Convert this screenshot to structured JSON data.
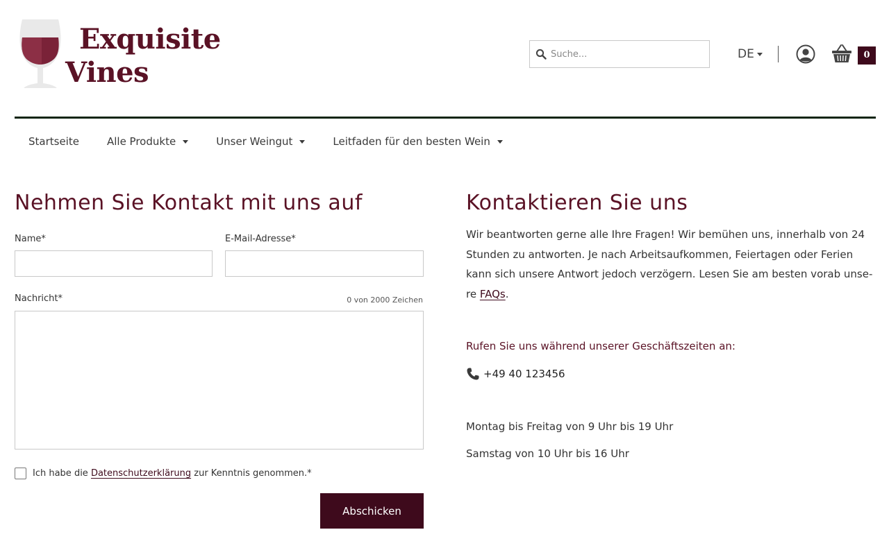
{
  "brand": {
    "name_line1": "Exquisite",
    "name_line2": "Vines",
    "color": "#5a1225",
    "icon": "wine-glass-icon"
  },
  "header": {
    "search": {
      "placeholder": "Suche...",
      "value": "",
      "icon": "search-icon"
    },
    "language": "DE",
    "account_icon": "user-icon",
    "cart": {
      "icon": "basket-icon",
      "count": "0"
    }
  },
  "nav": {
    "items": [
      {
        "label": "Startseite",
        "has_dropdown": false
      },
      {
        "label": "Alle Produkte",
        "has_dropdown": true
      },
      {
        "label": "Unser Weingut",
        "has_dropdown": true
      },
      {
        "label": "Leitfaden für den besten Wein",
        "has_dropdown": true
      }
    ]
  },
  "form": {
    "heading": "Nehmen Sie Kontakt mit uns auf",
    "name_label": "Name*",
    "name_value": "",
    "email_label": "E-Mail-Adresse*",
    "email_value": "",
    "message_label": "Nachricht*",
    "message_value": "",
    "char_counter": "0 von 2000 Zeichen",
    "consent": {
      "checked": false,
      "prefix": "Ich habe die",
      "link": "Datenschutzerklärung",
      "suffix": "zur Kenntnis genommen.*"
    },
    "submit_label": "Abschicken"
  },
  "contact": {
    "heading": "Kontaktieren Sie uns",
    "intro": "Wir beantworten gerne alle Ihre Fragen! Wir bemühen uns, innerhalb von 24 Stunden zu antworten. Je nach Arbeitsaufkommen, Feiertagen oder Ferien kann sich unsere Antwort jedoch verzögern. Lesen Sie am besten vorab unse-re",
    "faq_link": "FAQs",
    "intro_end": ".",
    "hours_heading": "Rufen Sie uns während unserer Geschäftszeiten an:",
    "phone_icon": "phone-icon",
    "phone": "+49 40 123456",
    "hours_weekdays": "Montag bis Freitag von 9 Uhr bis 19 Uhr",
    "hours_saturday": "Samstag von 10 Uhr bis 16 Uhr"
  },
  "colors": {
    "accent": "#3e0a1c",
    "heading": "#5a1225",
    "divider": "#0d2410"
  }
}
